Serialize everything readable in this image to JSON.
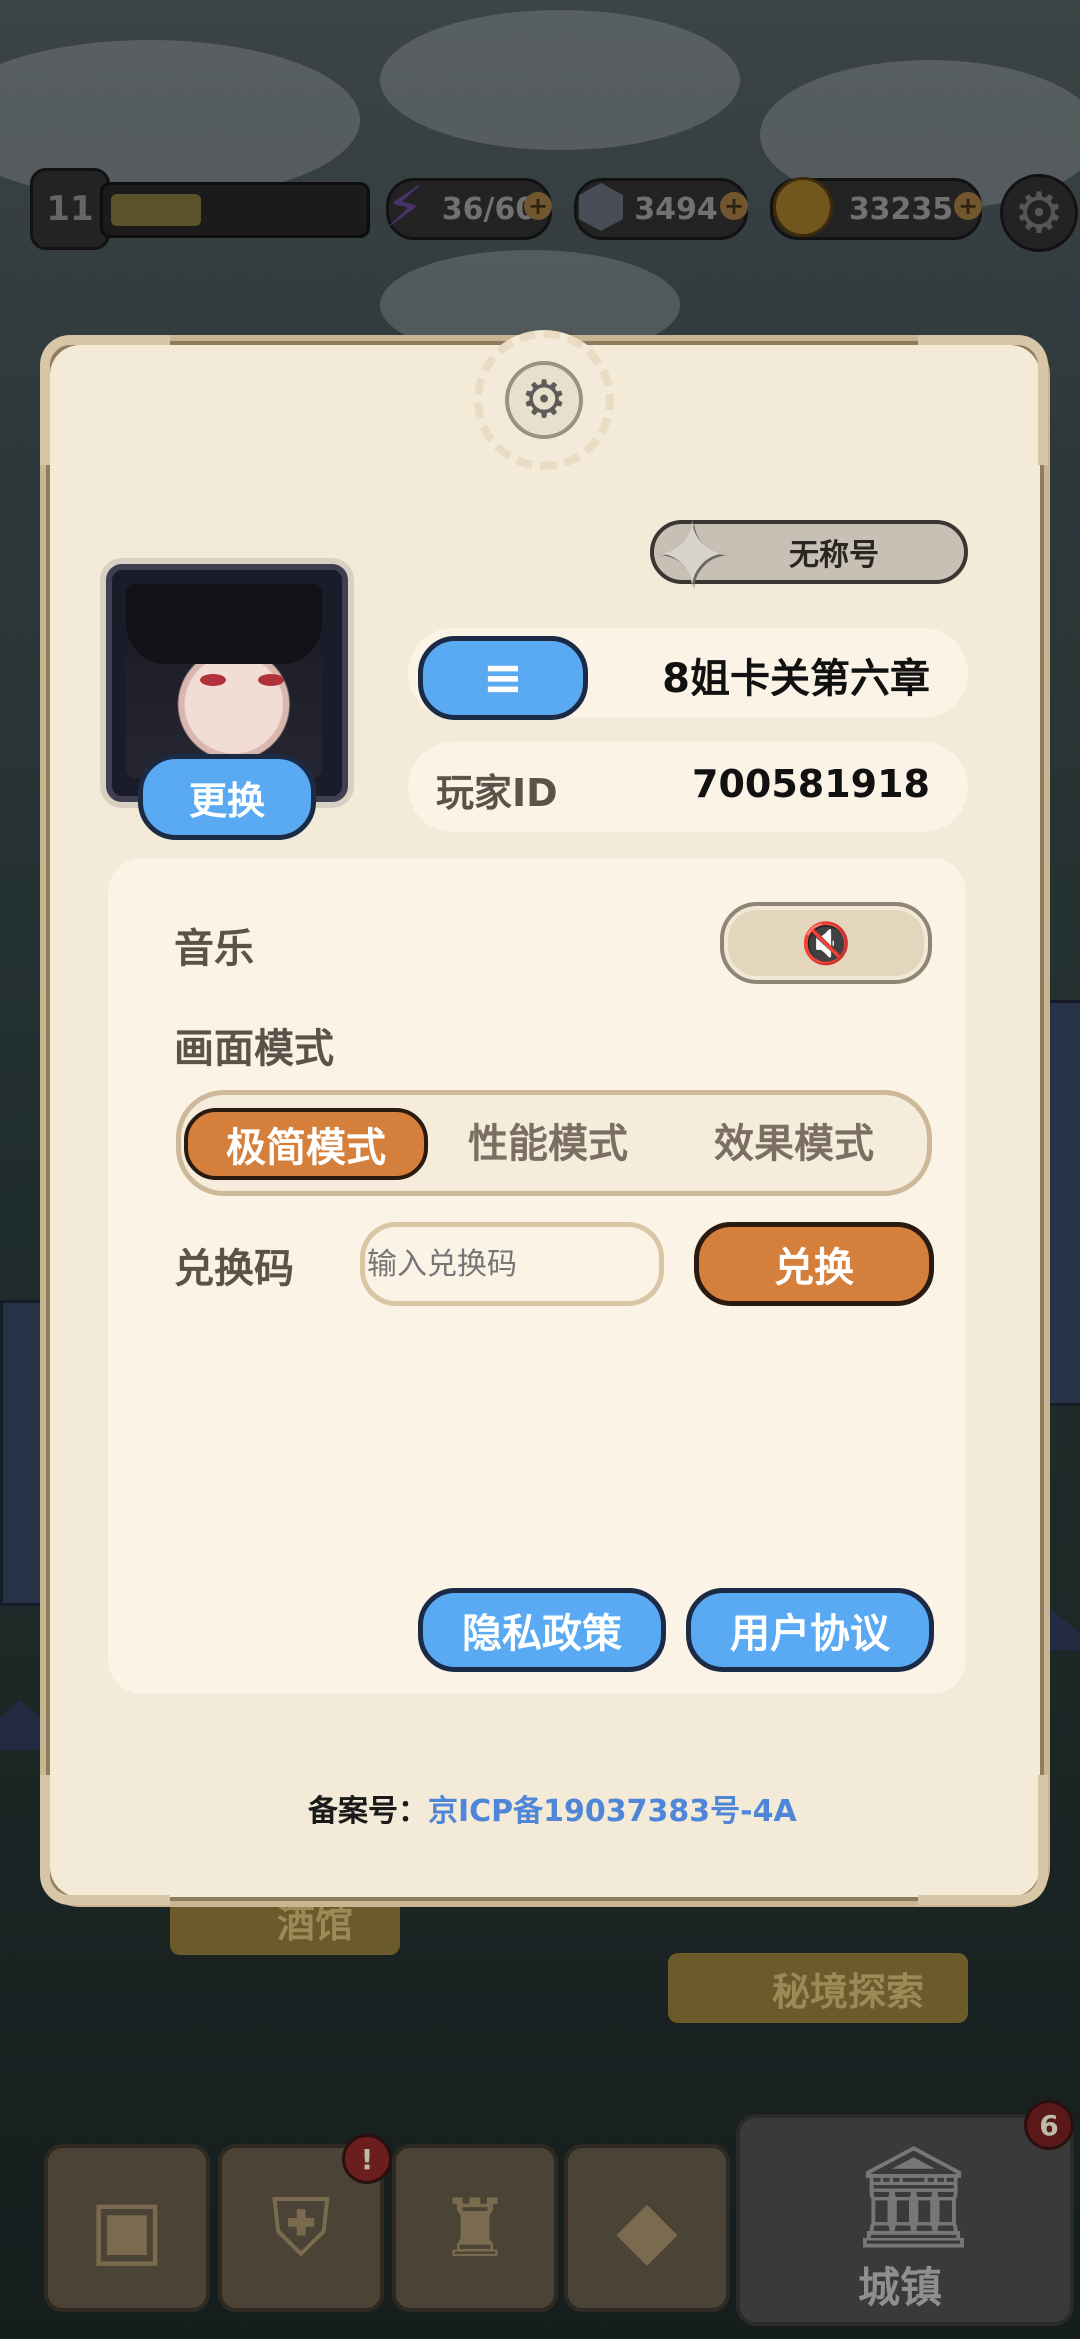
{
  "hud": {
    "level": "11",
    "energy": "36/60",
    "gems": "3494",
    "gold": "33235"
  },
  "settings": {
    "title_badge": "无称号",
    "player_name": "8姐卡关第六章",
    "player_id_label": "玩家ID",
    "player_id": "700581918",
    "change_avatar_button": "更换",
    "music_label": "音乐",
    "display_mode_label": "画面模式",
    "display_modes": [
      "极简模式",
      "性能模式",
      "效果模式"
    ],
    "selected_mode": "极简模式",
    "redeem_label": "兑换码",
    "redeem_placeholder": "输入兑换码",
    "redeem_button": "兑换",
    "privacy_button": "隐私政策",
    "agreement_button": "用户协议",
    "icp_label": "备案号：",
    "icp_number": "京ICP备19037383号-4A"
  },
  "map_labels": {
    "tavern": "酒馆",
    "secret_realm": "秘境探索"
  },
  "dock": {
    "town_label": "城镇",
    "town_badge": "6",
    "heroes_badge": "!"
  },
  "colors": {
    "accent_orange": "#d4803c",
    "accent_blue": "#5aaaf3",
    "panel_bg": "#f4ead8",
    "icp_link": "#4f86d8"
  },
  "icons": {
    "settings": "gear-icon",
    "music_off": "speaker-muted-icon",
    "title": "star-badge-icon",
    "name_edit": "name-card-icon"
  }
}
